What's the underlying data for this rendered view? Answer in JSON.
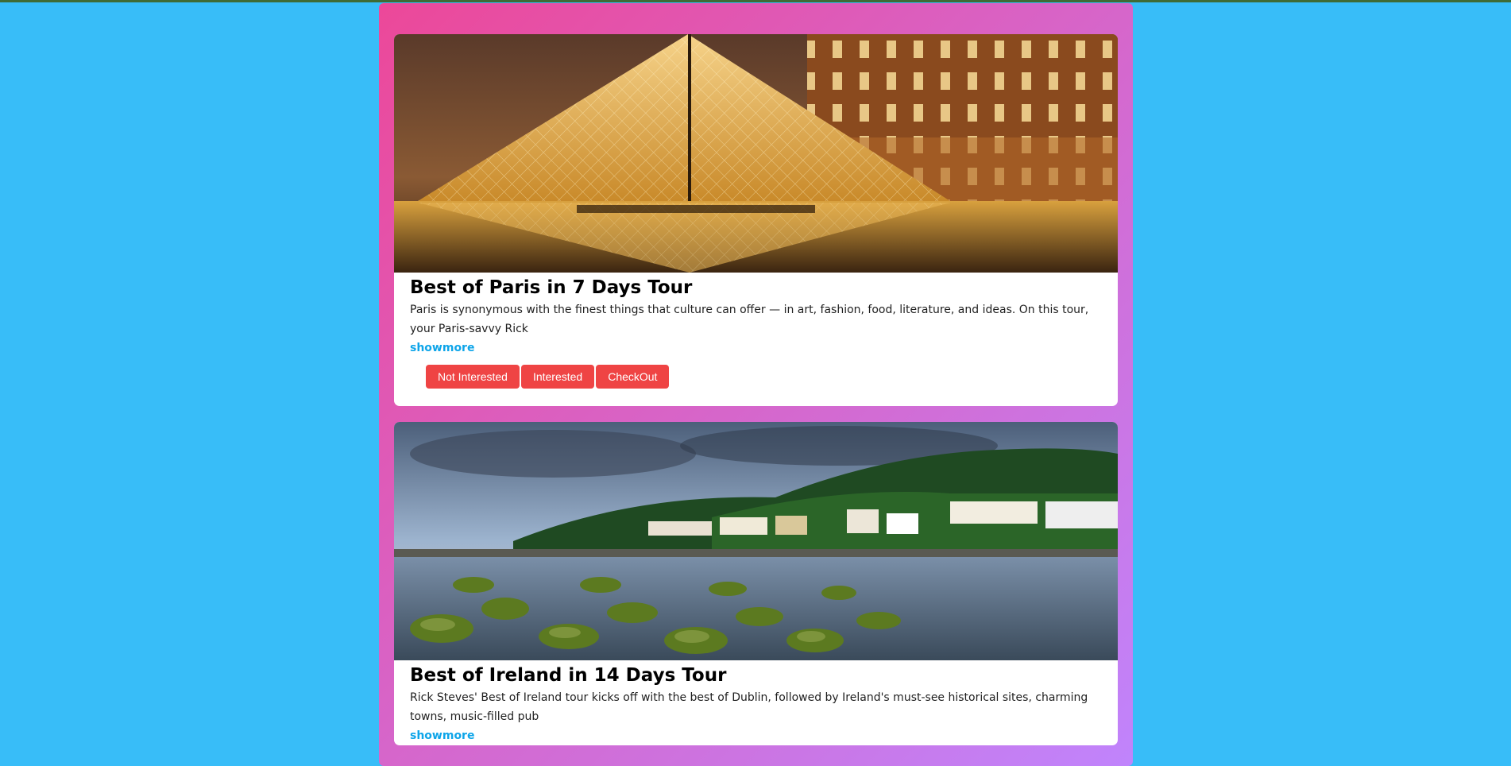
{
  "tours": [
    {
      "title": "Best of Paris in 7 Days Tour",
      "description": "Paris is synonymous with the finest things that culture can offer — in art, fashion, food, literature, and ideas. On this tour, your Paris-savvy Rick",
      "show_more_label": "showmore",
      "buttons": {
        "not_interested": "Not Interested",
        "interested": "Interested",
        "checkout": "CheckOut"
      }
    },
    {
      "title": "Best of Ireland in 14 Days Tour",
      "description": "Rick Steves' Best of Ireland tour kicks off with the best of Dublin, followed by Ireland's must-see historical sites, charming towns, music-filled pub",
      "show_more_label": "showmore"
    }
  ],
  "colors": {
    "background": "#38bdf8",
    "gradient_start": "#ec4899",
    "gradient_end": "#c084fc",
    "button": "#ef4444",
    "link": "#0ea5e9"
  }
}
